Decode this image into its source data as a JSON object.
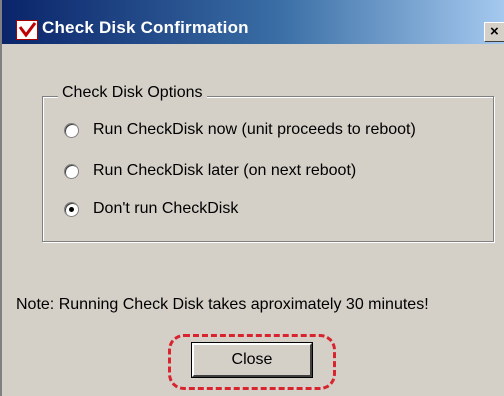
{
  "window": {
    "title": "Check Disk Confirmation",
    "close_glyph": "×"
  },
  "group": {
    "label": "Check Disk Options",
    "options": [
      {
        "label": "Run CheckDisk now (unit proceeds to reboot)",
        "checked": false
      },
      {
        "label": "Run CheckDisk later (on next reboot)",
        "checked": false
      },
      {
        "label": "Don't run CheckDisk",
        "checked": true
      }
    ]
  },
  "note": "Note: Running Check Disk takes aproximately 30 minutes!",
  "buttons": {
    "close_label": "Close"
  },
  "colors": {
    "highlight": "#d9232e",
    "titlebar_start": "#0a246a",
    "titlebar_end": "#a6caf0"
  },
  "icons": {
    "app": "checkmark-app-icon"
  }
}
